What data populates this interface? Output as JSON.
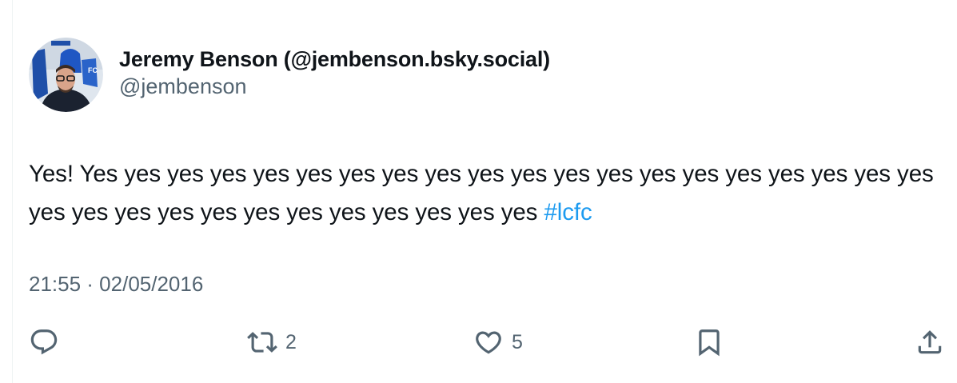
{
  "author": {
    "display_name": "Jeremy Benson (@jembenson.bsky.social)",
    "handle": "@jembenson",
    "avatar_logo_text": "LCFC"
  },
  "post": {
    "text": "Yes! Yes yes yes yes yes yes yes yes yes yes yes yes yes yes yes yes yes yes yes yes yes yes yes yes yes yes yes yes yes yes yes yes",
    "hashtag": "#lcfc",
    "timestamp": "21:55 · 02/05/2016"
  },
  "actions": {
    "reply_icon": "reply-icon",
    "repost_icon": "repost-icon",
    "repost_count": "2",
    "like_icon": "heart-icon",
    "like_count": "5",
    "bookmark_icon": "bookmark-icon",
    "share_icon": "share-icon"
  },
  "colors": {
    "text_primary": "#0f1419",
    "text_secondary": "#536471",
    "link": "#1d9bf0"
  }
}
